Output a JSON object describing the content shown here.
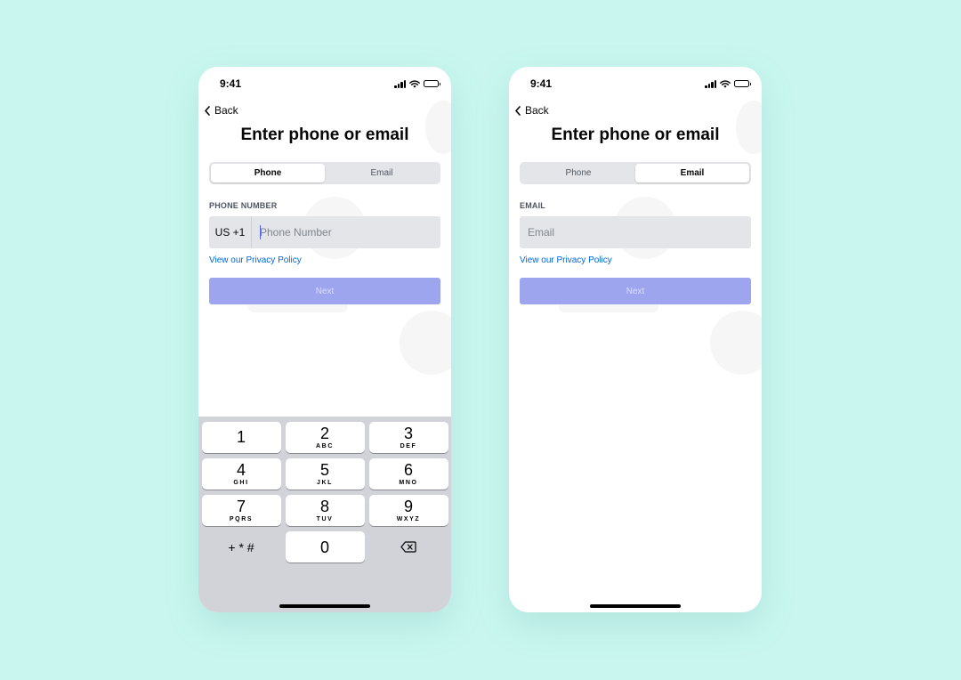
{
  "phone_screen": {
    "status": {
      "time": "9:41"
    },
    "back_label": "Back",
    "title": "Enter phone or email",
    "tabs": [
      {
        "label": "Phone",
        "active": true
      },
      {
        "label": "Email",
        "active": false
      }
    ],
    "field_label": "PHONE NUMBER",
    "country_code": "US +1",
    "input_placeholder": "Phone Number",
    "privacy_link": "View our Privacy Policy",
    "next_label": "Next",
    "keypad": [
      {
        "num": "1",
        "letters": ""
      },
      {
        "num": "2",
        "letters": "ABC"
      },
      {
        "num": "3",
        "letters": "DEF"
      },
      {
        "num": "4",
        "letters": "GHI"
      },
      {
        "num": "5",
        "letters": "JKL"
      },
      {
        "num": "6",
        "letters": "MNO"
      },
      {
        "num": "7",
        "letters": "PQRS"
      },
      {
        "num": "8",
        "letters": "TUV"
      },
      {
        "num": "9",
        "letters": "WXYZ"
      }
    ],
    "keypad_symbols": "+ * #",
    "keypad_zero": "0"
  },
  "email_screen": {
    "status": {
      "time": "9:41"
    },
    "back_label": "Back",
    "title": "Enter phone or email",
    "tabs": [
      {
        "label": "Phone",
        "active": false
      },
      {
        "label": "Email",
        "active": true
      }
    ],
    "field_label": "EMAIL",
    "input_placeholder": "Email",
    "privacy_link": "View our Privacy Policy",
    "next_label": "Next"
  },
  "colors": {
    "background": "#c9f7f0",
    "accent_disabled": "#9da5ef",
    "link": "#0068e0",
    "input_bg": "#e3e5e8",
    "keypad_bg": "#d2d3d9"
  },
  "icons": [
    "chevron-left-icon",
    "signal-icon",
    "wifi-icon",
    "battery-icon",
    "backspace-icon"
  ]
}
